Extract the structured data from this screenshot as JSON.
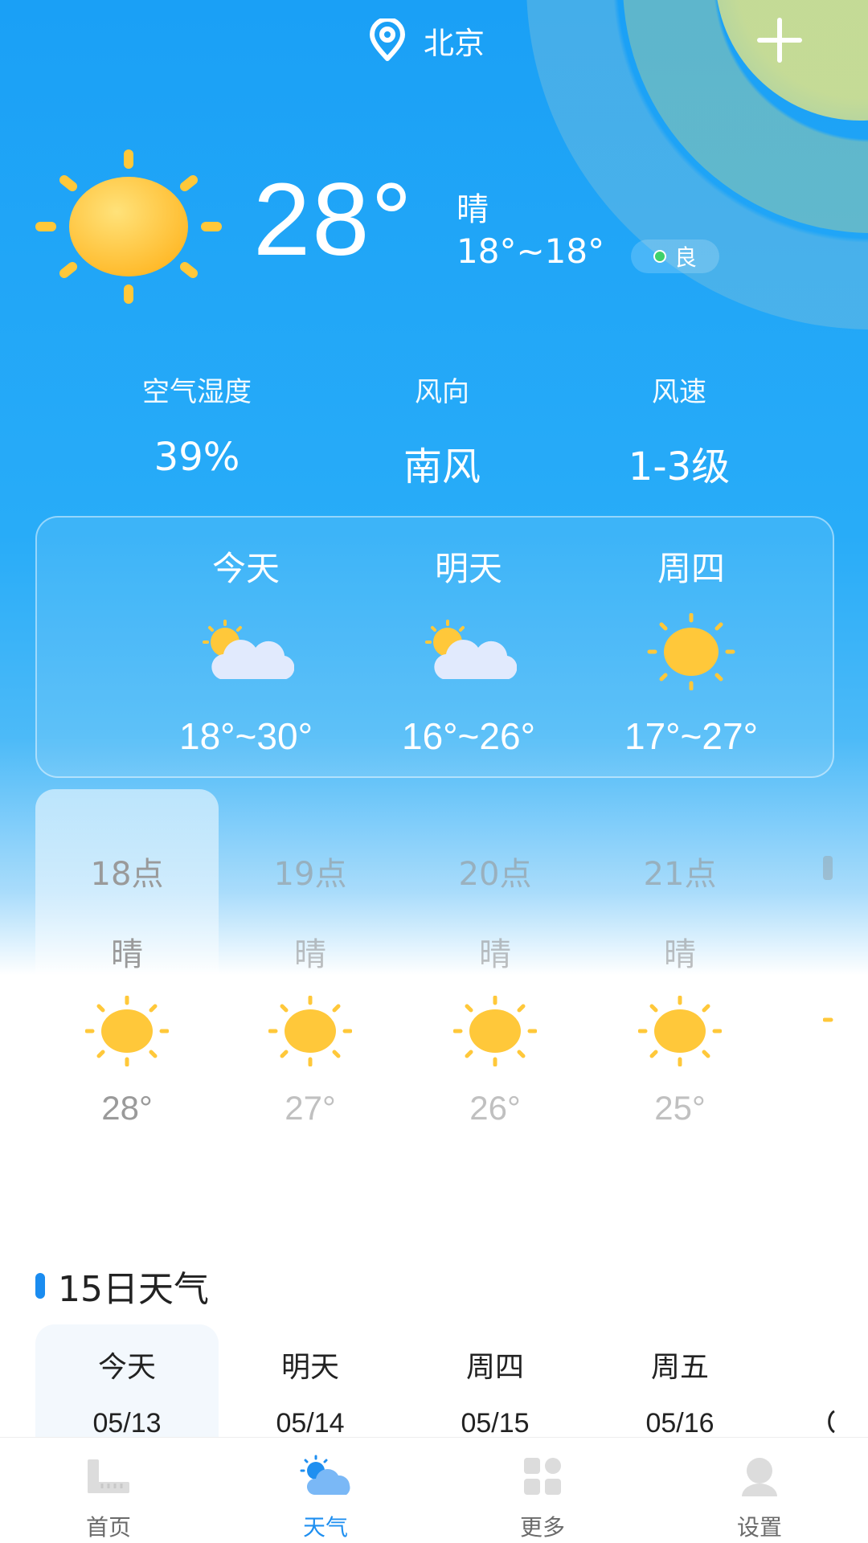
{
  "header": {
    "city": "北京"
  },
  "current": {
    "temp": "28°",
    "condition": "晴",
    "range": "18°~18°",
    "aqi": "良"
  },
  "stats": [
    {
      "label": "空气湿度",
      "value": "39%"
    },
    {
      "label": "风向",
      "value": "南风"
    },
    {
      "label": "风速",
      "value": "1-3级"
    }
  ],
  "three_day": [
    {
      "name": "今天",
      "range": "18°~30°",
      "icon": "partly-cloudy-icon"
    },
    {
      "name": "明天",
      "range": "16°~26°",
      "icon": "partly-cloudy-icon"
    },
    {
      "name": "周四",
      "range": "17°~27°",
      "icon": "sun-icon"
    }
  ],
  "hourly": [
    {
      "time": "18点",
      "cond": "晴",
      "temp": "28°"
    },
    {
      "time": "19点",
      "cond": "晴",
      "temp": "27°"
    },
    {
      "time": "20点",
      "cond": "晴",
      "temp": "26°"
    },
    {
      "time": "21点",
      "cond": "晴",
      "temp": "25°"
    }
  ],
  "fifteen": {
    "title": "15日天气",
    "days": [
      {
        "name": "今天",
        "date": "05/13"
      },
      {
        "name": "明天",
        "date": "05/14"
      },
      {
        "name": "周四",
        "date": "05/15"
      },
      {
        "name": "周五",
        "date": "05/16"
      }
    ]
  },
  "nav": [
    {
      "label": "首页",
      "icon": "home-icon"
    },
    {
      "label": "天气",
      "icon": "weather-icon"
    },
    {
      "label": "更多",
      "icon": "grid-icon"
    },
    {
      "label": "设置",
      "icon": "person-icon"
    }
  ],
  "colors": {
    "accent": "#1f8ff0",
    "sky": "#1aa0f6",
    "sun": "#ffc83a"
  }
}
